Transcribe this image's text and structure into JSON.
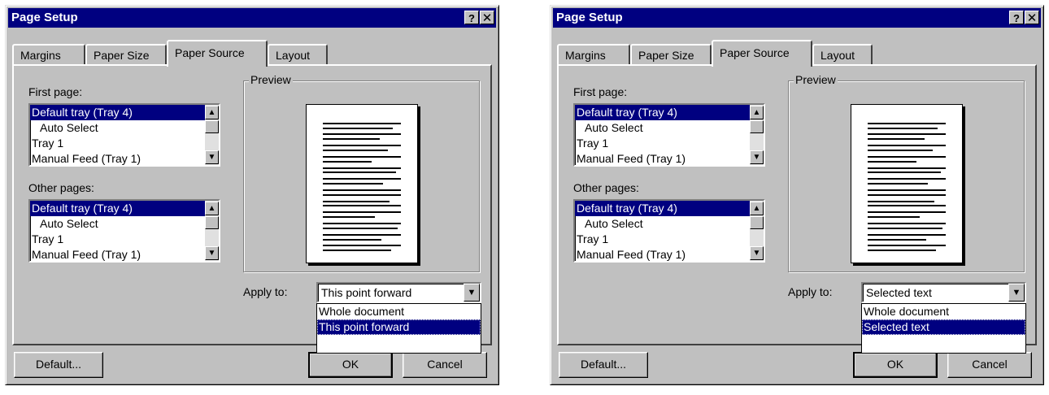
{
  "dialogs": [
    {
      "title": "Page Setup",
      "help_glyph": "?",
      "close_glyph": "✕",
      "tabs": [
        "Margins",
        "Paper Size",
        "Paper Source",
        "Layout"
      ],
      "active_tab": "Paper Source",
      "first_page_label": "First page:",
      "first_page_items": [
        "Default tray (Tray 4)",
        "Auto Select",
        "Tray 1",
        "Manual Feed (Tray 1)"
      ],
      "first_page_selected": "Default tray (Tray 4)",
      "other_pages_label": "Other pages:",
      "other_pages_items": [
        "Default tray (Tray 4)",
        "Auto Select",
        "Tray 1",
        "Manual Feed (Tray 1)"
      ],
      "other_pages_selected": "Default tray (Tray 4)",
      "preview_label": "Preview",
      "apply_to_label": "Apply to:",
      "apply_to_value": "This point forward",
      "apply_to_options": [
        "Whole document",
        "This point forward"
      ],
      "apply_to_highlighted": "This point forward",
      "default_button": "Default...",
      "ok_button": "OK",
      "cancel_button": "Cancel"
    },
    {
      "title": "Page Setup",
      "help_glyph": "?",
      "close_glyph": "✕",
      "tabs": [
        "Margins",
        "Paper Size",
        "Paper Source",
        "Layout"
      ],
      "active_tab": "Paper Source",
      "first_page_label": "First page:",
      "first_page_items": [
        "Default tray (Tray 4)",
        "Auto Select",
        "Tray 1",
        "Manual Feed (Tray 1)"
      ],
      "first_page_selected": "Default tray (Tray 4)",
      "other_pages_label": "Other pages:",
      "other_pages_items": [
        "Default tray (Tray 4)",
        "Auto Select",
        "Tray 1",
        "Manual Feed (Tray 1)"
      ],
      "other_pages_selected": "Default tray (Tray 4)",
      "preview_label": "Preview",
      "apply_to_label": "Apply to:",
      "apply_to_value": "Selected text",
      "apply_to_options": [
        "Whole document",
        "Selected text"
      ],
      "apply_to_highlighted": "Selected text",
      "default_button": "Default...",
      "ok_button": "OK",
      "cancel_button": "Cancel"
    }
  ],
  "colors": {
    "face": "#c0c0c0",
    "titlebar": "#000080",
    "selection": "#000080"
  }
}
